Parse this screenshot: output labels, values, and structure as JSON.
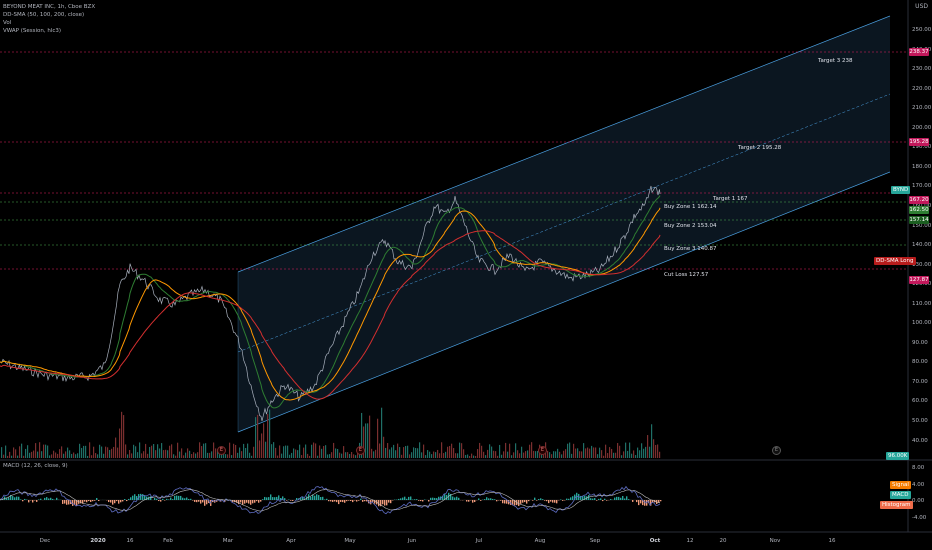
{
  "legend": {
    "symbol": "BEYOND MEAT INC, 1h, Cboe BZX",
    "ind1": "DD-SMA (50, 100, 200, close)",
    "ind2": "Vol",
    "ind3": "VWAP (Session, hlc3)"
  },
  "currency": "USD",
  "annotations": {
    "target3": "Target 3 238",
    "target2": "Target 2 195.28",
    "target1": "Target 1 167",
    "buy1": "Buy Zone 1 162.14",
    "buy2": "Buy Zone 2 153.04",
    "buy3": "Buy Zone 3 140.87",
    "cutloss": "Cut Loss 127.57"
  },
  "price_axis": {
    "ticks": [
      "250.00",
      "240.00",
      "230.00",
      "220.00",
      "210.00",
      "200.00",
      "190.00",
      "180.00",
      "170.00",
      "160.00",
      "150.00",
      "140.00",
      "130.00",
      "120.00",
      "110.00",
      "100.00",
      "90.00",
      "80.00",
      "70.00",
      "60.00",
      "50.00",
      "40.00"
    ]
  },
  "badges": {
    "p238": "238.37",
    "p195": "195.28",
    "bynd": "BYND",
    "p167": "167.20",
    "p162": "162.50",
    "p157": "157.14",
    "p127": "127.87",
    "sma_label": "DD-SMA Long",
    "vol_badge": "96.00K"
  },
  "macd": {
    "label": "MACD (12, 26, close, 9)",
    "ticks": [
      "8.00",
      "4.00",
      "0.00",
      "-4.00"
    ],
    "signal": "Signal",
    "macd": "MACD",
    "histogram": "Histogram"
  },
  "time_axis": {
    "ticks": [
      {
        "label": "Dec",
        "bold": false
      },
      {
        "label": "2020",
        "bold": true
      },
      {
        "label": "16",
        "bold": false
      },
      {
        "label": "Feb",
        "bold": false
      },
      {
        "label": "Mar",
        "bold": false
      },
      {
        "label": "Apr",
        "bold": false
      },
      {
        "label": "May",
        "bold": false
      },
      {
        "label": "Jun",
        "bold": false
      },
      {
        "label": "Jul",
        "bold": false
      },
      {
        "label": "Aug",
        "bold": false
      },
      {
        "label": "Sep",
        "bold": false
      },
      {
        "label": "Oct",
        "bold": true
      },
      {
        "label": "12",
        "bold": false
      },
      {
        "label": "20",
        "bold": false
      },
      {
        "label": "Nov",
        "bold": false
      },
      {
        "label": "16",
        "bold": false
      }
    ]
  },
  "earnings_marker": "E",
  "colors": {
    "background": "#000000",
    "channel": "#4a9fe0",
    "level_red": "#e91e63",
    "level_green": "#4caf50",
    "sma50": "#2e7d32",
    "sma100": "#ff9800",
    "sma200": "#d32f2f",
    "price": "#a8b0bd",
    "volume_up": "#26a69a",
    "volume_down": "#ef5350"
  }
}
